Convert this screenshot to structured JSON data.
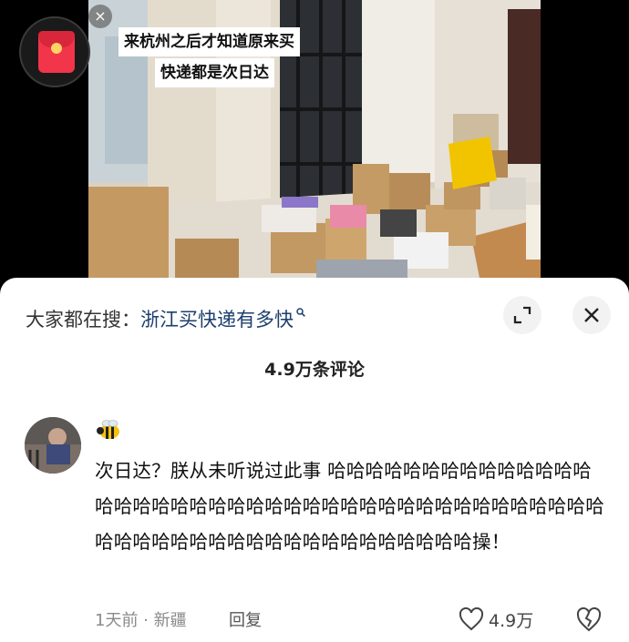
{
  "video": {
    "caption_line1": "来杭州之后才知道原来买",
    "caption_line2": "快递都是次日达",
    "close_glyph": "×"
  },
  "redpacket": {
    "icon": "red-envelope-icon"
  },
  "search": {
    "label": "大家都在搜：",
    "term": "浙江买快递有多快"
  },
  "comments": {
    "count_label": "4.9万条评论",
    "item": {
      "badge": "bee-emoji",
      "text": "次日达？朕从未听说过此事 哈哈哈哈哈哈哈哈哈哈哈哈哈哈哈哈哈哈哈哈哈哈哈哈哈哈哈哈哈哈哈哈哈哈哈哈哈哈哈哈哈哈哈哈哈哈哈哈哈哈哈哈哈哈哈哈哈哈哈哈哈操！",
      "time": "1天前",
      "location": "新疆",
      "separator": " · ",
      "reply_label": "回复",
      "like_count": "4.9万"
    }
  },
  "colors": {
    "search_term": "#1d3f6e",
    "panel_bg": "#ffffff",
    "redpacket": "#f2354a"
  }
}
